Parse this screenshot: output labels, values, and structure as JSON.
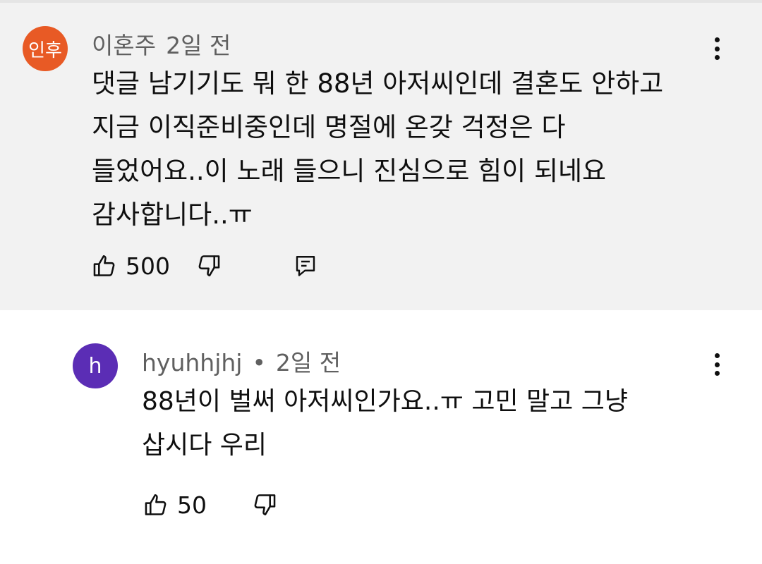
{
  "comments": [
    {
      "avatar_letters": "인후",
      "avatar_color": "#e85a25",
      "author": "이혼주",
      "separator": "",
      "time": "2일 전",
      "lines": [
        "댓글 남기기도 뭐 한 88년 아저씨인데 결혼도 안하고",
        "지금 이직준비중인데 명절에 온갖 걱정은 다",
        "들었어요..이 노래 들으니 진심으로 힘이 되네요",
        "감사합니다..ㅠ"
      ],
      "likes": "500",
      "has_reply_button": true,
      "icons": [
        "like-icon",
        "dislike-icon",
        "reply-icon",
        "more-vert-icon"
      ]
    },
    {
      "avatar_letters": "h",
      "avatar_color": "#5b2db5",
      "author": "hyuhhjhj",
      "separator": "•",
      "time": "2일 전",
      "lines": [
        "88년이 벌써 아저씨인가요..ㅠ 고민 말고 그냥",
        "삽시다 우리"
      ],
      "likes": "50",
      "has_reply_button": false,
      "icons": [
        "like-icon",
        "dislike-icon",
        "more-vert-icon"
      ]
    }
  ]
}
